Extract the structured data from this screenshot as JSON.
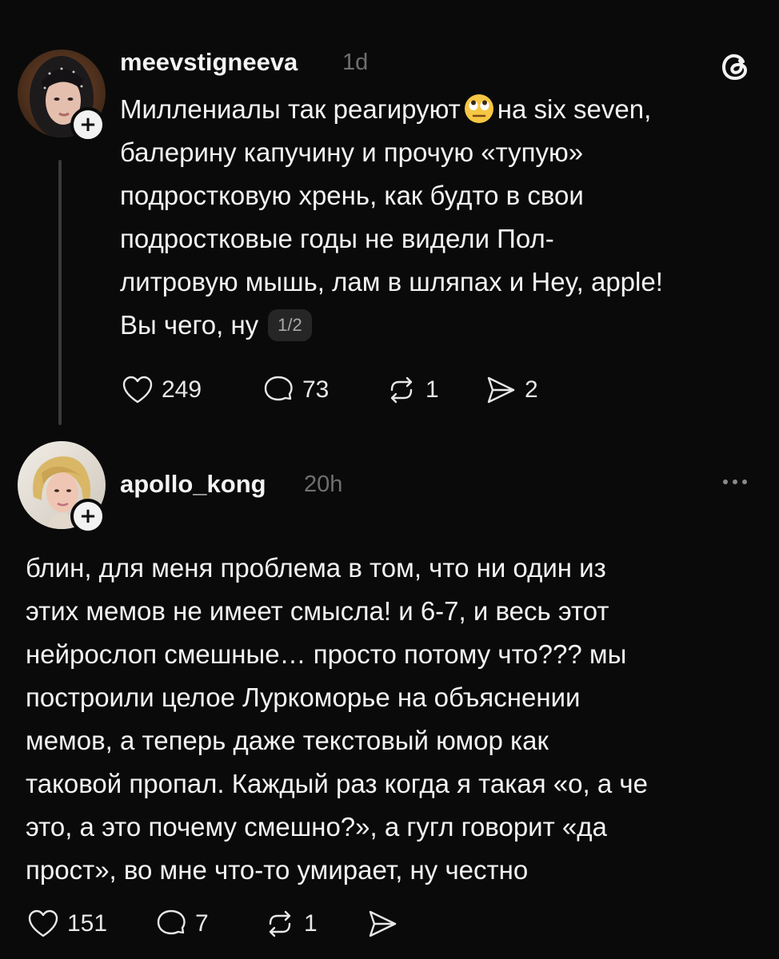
{
  "posts": [
    {
      "username": "meevstigneeva",
      "time": "1d",
      "text_lines": [
        [
          "Миллениалы так реагируют",
          "на six seven,"
        ],
        "балерину капучину и прочую «тупую»",
        "подростковую хрень, как будто в свои",
        "подростковые годы не видели Пол-",
        "литровую мышь, лам в шляпах и Hey, apple!",
        "Вы чего, ну"
      ],
      "emoji": "eye-roll-emoji",
      "page_badge": "1/2",
      "likes": "249",
      "replies": "73",
      "reposts": "1",
      "shares": "2",
      "logo": "threads-logo-icon"
    },
    {
      "username": "apollo_kong",
      "time": "20h",
      "text_lines": [
        "блин, для меня проблема в том, что ни один из",
        "этих мемов не имеет смысла! и 6-7, и весь этот",
        "нейрослоп смешные… просто потому что??? мы",
        "построили целое Луркоморье на объяснении",
        "мемов, а теперь даже текстовый юмор как",
        "таковой пропал. Каждый раз когда я такая «о, а че",
        "это, а это почему смешно?», а гугл говорит «да",
        "прост», во мне что-то умирает, ну честно"
      ],
      "likes": "151",
      "replies": "7",
      "reposts": "1"
    }
  ],
  "colors": {
    "background": "#0a0a0a",
    "text": "#f3f3f3",
    "muted": "#6f6f6f"
  }
}
